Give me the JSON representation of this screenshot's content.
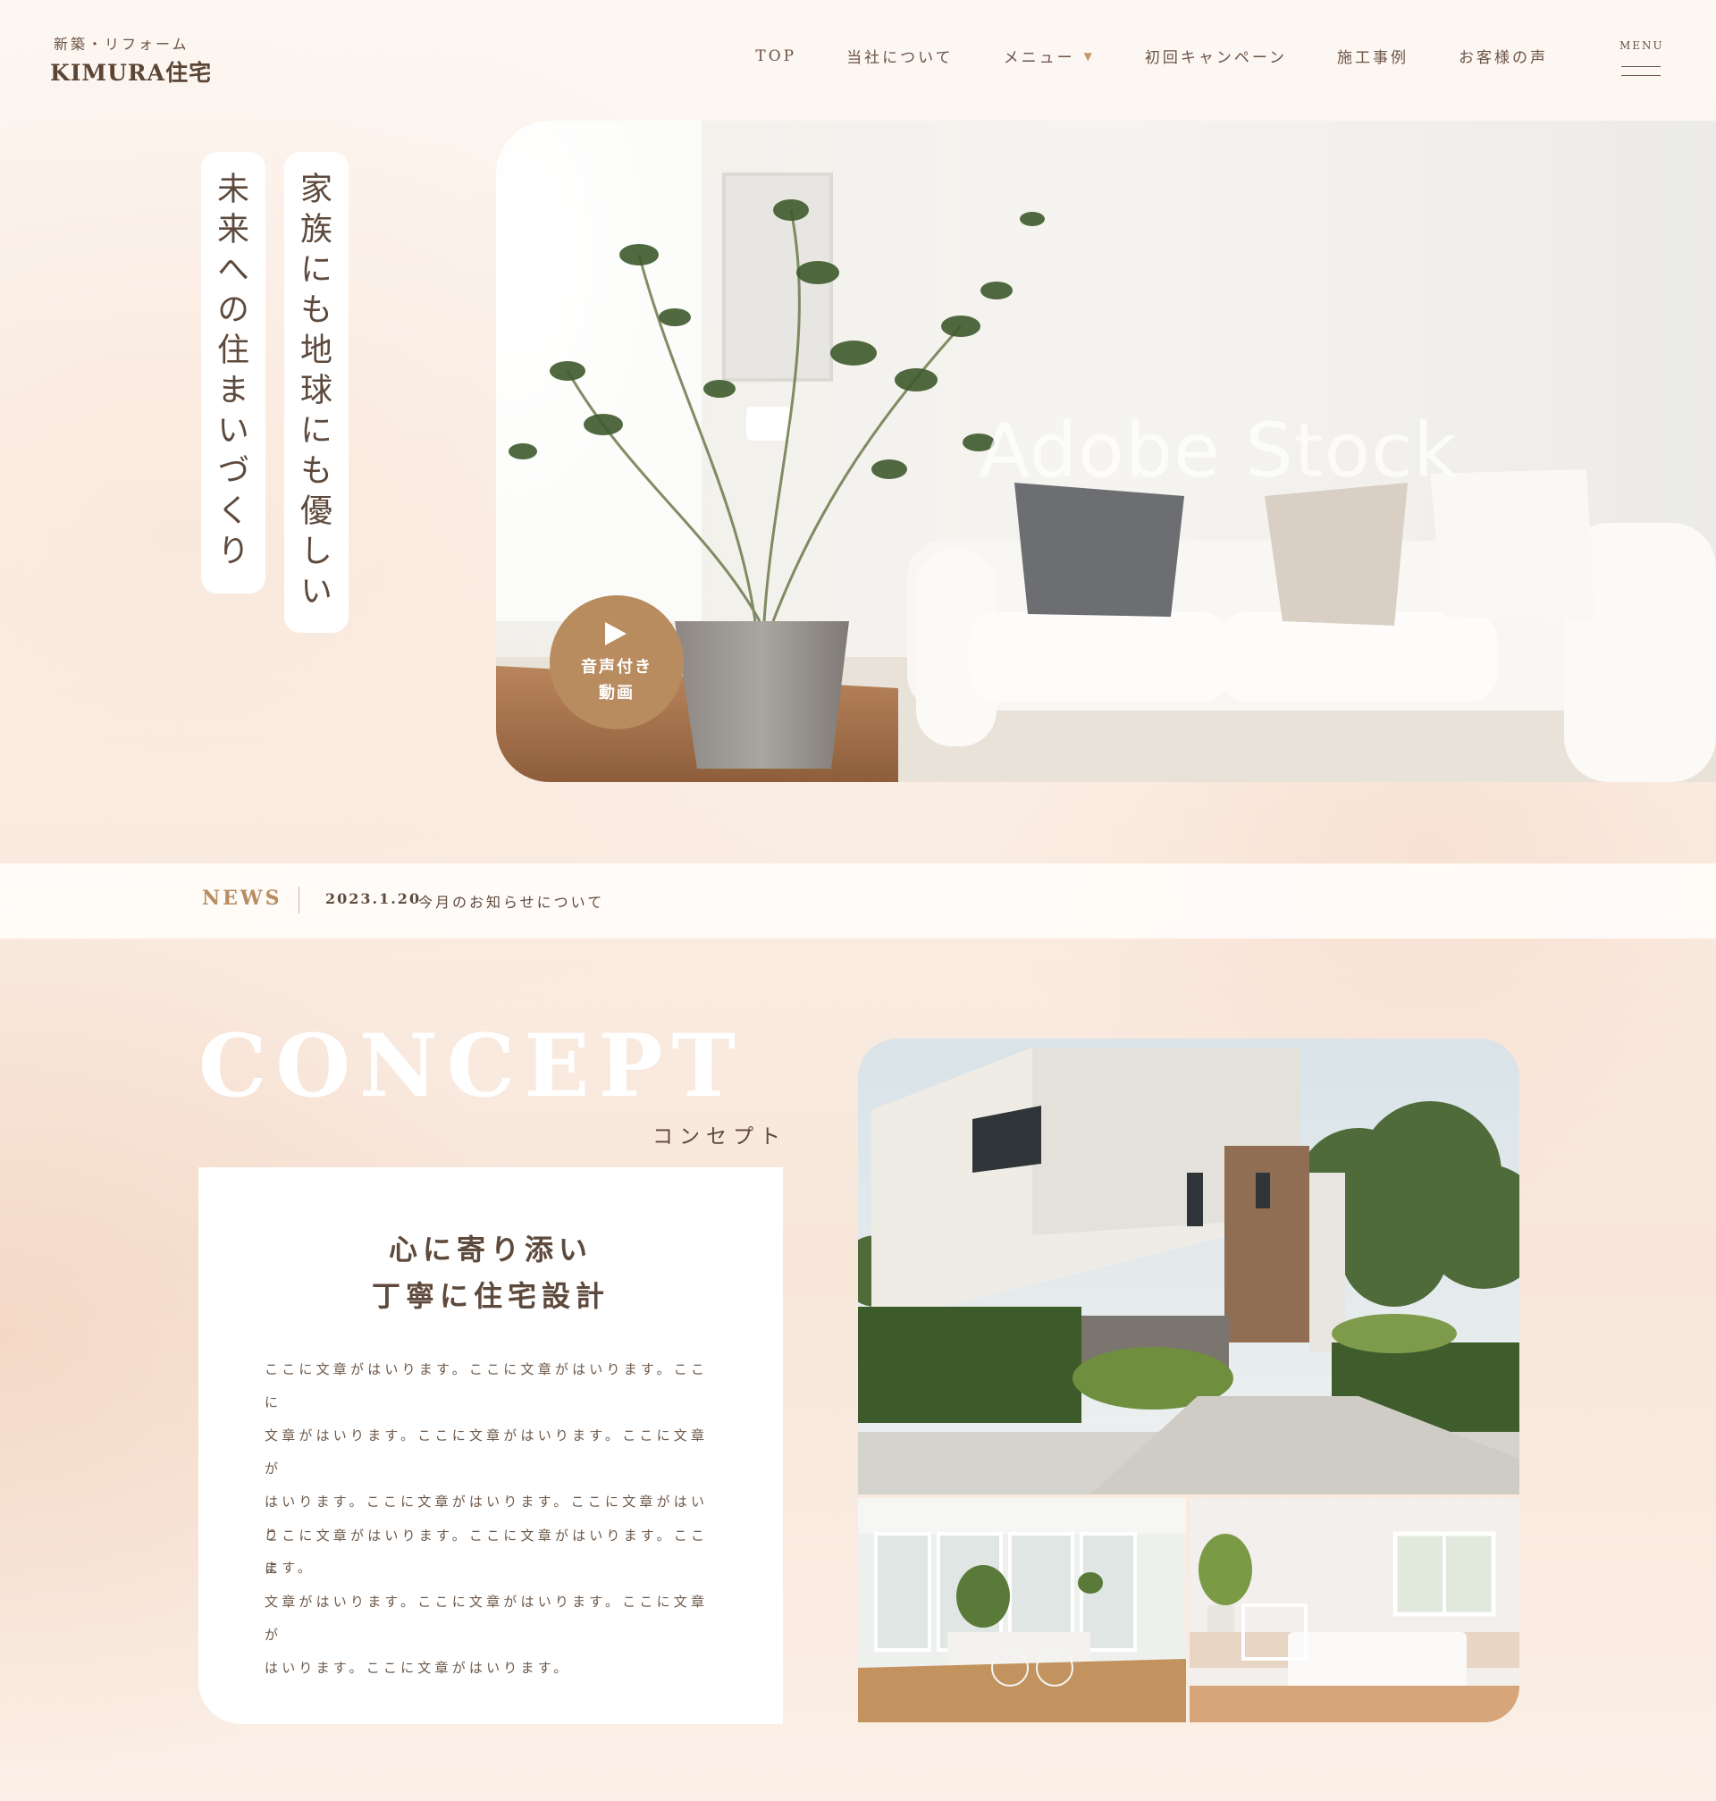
{
  "header": {
    "logo_sub": "新築・リフォーム",
    "logo_main": "KIMURA住宅",
    "nav": [
      {
        "label": "TOP"
      },
      {
        "label": "当社について"
      },
      {
        "label": "メニュー",
        "has_dropdown": true,
        "dropdown_icon": "triangle-down"
      },
      {
        "label": "初回キャンペーン"
      },
      {
        "label": "施工事例"
      },
      {
        "label": "お客様の声"
      }
    ],
    "menu_label": "MENU",
    "menu_icon": "hamburger-icon"
  },
  "hero": {
    "catch_right": "家族にも地球にも優しい",
    "catch_left": "未来への住まいづくり",
    "watermark": "Adobe Stock",
    "play_button": {
      "icon": "play-icon",
      "line1": "音声付き",
      "line2": "動画"
    }
  },
  "news": {
    "title": "NEWS",
    "date": "2023.1.20",
    "text": "今月のお知らせについて"
  },
  "concept": {
    "title": "CONCEPT",
    "subtitle": "コンセプト",
    "heading_line1": "心に寄り添い",
    "heading_line2": "丁寧に住宅設計",
    "paragraph1_lines": [
      "ここに文章がはいります。ここに文章がはいります。ここに",
      "文章がはいります。ここに文章がはいります。ここに文章が",
      "はいります。ここに文章がはいります。ここに文章がはいり",
      "ます。"
    ],
    "paragraph2_lines": [
      "ここに文章がはいります。ここに文章がはいります。ここに",
      "文章がはいります。ここに文章がはいります。ここに文章が",
      "はいります。ここに文章がはいります。"
    ]
  },
  "colors": {
    "accent": "#b98c60",
    "text": "#5e4a3c",
    "background": "#fbefe6"
  }
}
